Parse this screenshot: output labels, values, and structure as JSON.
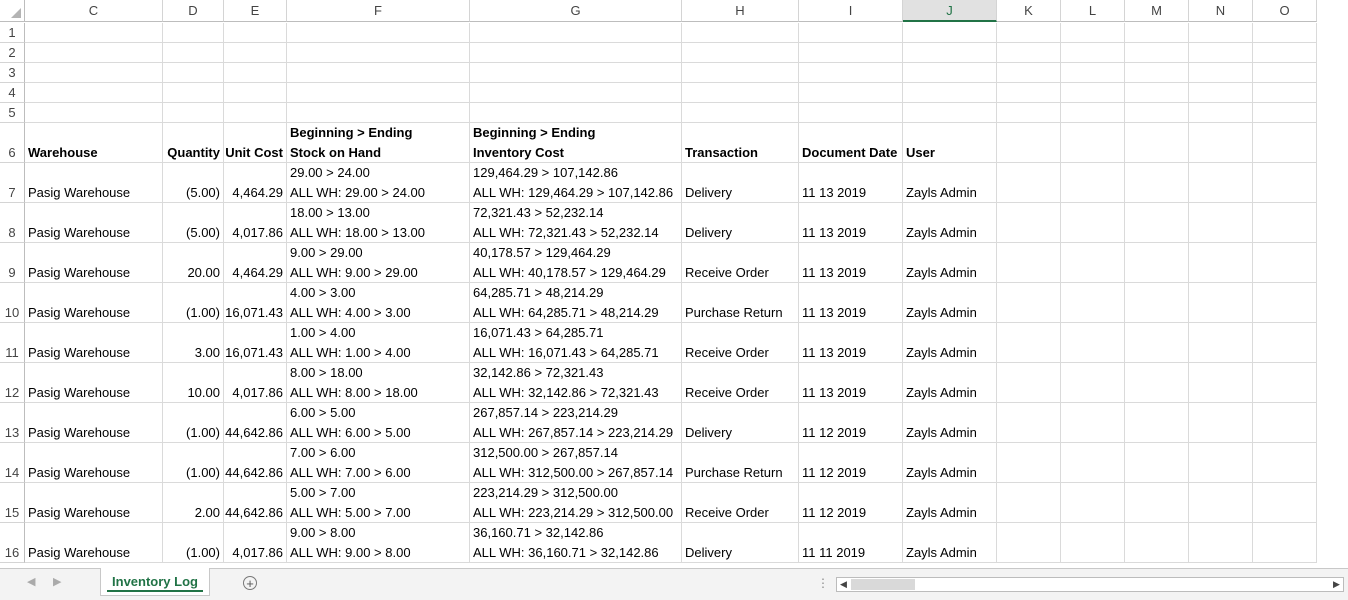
{
  "columns": [
    "C",
    "D",
    "E",
    "F",
    "G",
    "H",
    "I",
    "J",
    "K",
    "L",
    "M",
    "N",
    "O"
  ],
  "selected_column": "J",
  "empty_rows": [
    "1",
    "2",
    "3",
    "4",
    "5"
  ],
  "header_row": {
    "num": "6",
    "warehouse": "Warehouse",
    "quantity": "Quantity",
    "unit_cost": "Unit Cost",
    "stock_top": "Beginning > Ending",
    "stock_bottom": "Stock on Hand",
    "inv_top": "Beginning > Ending",
    "inv_bottom": "Inventory Cost",
    "transaction": "Transaction",
    "document_date": "Document Date",
    "user": "User"
  },
  "rows": [
    {
      "num": "7",
      "warehouse": "Pasig Warehouse",
      "quantity": "(5.00)",
      "unit_cost": "4,464.29",
      "stock_top": "29.00 > 24.00",
      "stock_bottom": "ALL WH: 29.00 > 24.00",
      "inv_top": "129,464.29 > 107,142.86",
      "inv_bottom": "ALL WH: 129,464.29 > 107,142.86",
      "transaction": "Delivery",
      "date": "11 13 2019",
      "user": "Zayls Admin"
    },
    {
      "num": "8",
      "warehouse": "Pasig Warehouse",
      "quantity": "(5.00)",
      "unit_cost": "4,017.86",
      "stock_top": "18.00 > 13.00",
      "stock_bottom": "ALL WH: 18.00 > 13.00",
      "inv_top": "72,321.43 > 52,232.14",
      "inv_bottom": "ALL WH: 72,321.43 > 52,232.14",
      "transaction": "Delivery",
      "date": "11 13 2019",
      "user": "Zayls Admin"
    },
    {
      "num": "9",
      "warehouse": "Pasig Warehouse",
      "quantity": "20.00",
      "unit_cost": "4,464.29",
      "stock_top": "9.00 > 29.00",
      "stock_bottom": "ALL WH: 9.00 > 29.00",
      "inv_top": "40,178.57 > 129,464.29",
      "inv_bottom": "ALL WH: 40,178.57 > 129,464.29",
      "transaction": "Receive Order",
      "date": "11 13 2019",
      "user": "Zayls Admin"
    },
    {
      "num": "10",
      "warehouse": "Pasig Warehouse",
      "quantity": "(1.00)",
      "unit_cost": "16,071.43",
      "stock_top": "4.00 > 3.00",
      "stock_bottom": "ALL WH: 4.00 > 3.00",
      "inv_top": "64,285.71 > 48,214.29",
      "inv_bottom": "ALL WH: 64,285.71 > 48,214.29",
      "transaction": "Purchase Return",
      "date": "11 13 2019",
      "user": "Zayls Admin"
    },
    {
      "num": "11",
      "warehouse": "Pasig Warehouse",
      "quantity": "3.00",
      "unit_cost": "16,071.43",
      "stock_top": "1.00 > 4.00",
      "stock_bottom": "ALL WH: 1.00 > 4.00",
      "inv_top": "16,071.43 > 64,285.71",
      "inv_bottom": "ALL WH: 16,071.43 > 64,285.71",
      "transaction": "Receive Order",
      "date": "11 13 2019",
      "user": "Zayls Admin"
    },
    {
      "num": "12",
      "warehouse": "Pasig Warehouse",
      "quantity": "10.00",
      "unit_cost": "4,017.86",
      "stock_top": "8.00 > 18.00",
      "stock_bottom": "ALL WH: 8.00 > 18.00",
      "inv_top": "32,142.86 > 72,321.43",
      "inv_bottom": "ALL WH: 32,142.86 > 72,321.43",
      "transaction": "Receive Order",
      "date": "11 13 2019",
      "user": "Zayls Admin"
    },
    {
      "num": "13",
      "warehouse": "Pasig Warehouse",
      "quantity": "(1.00)",
      "unit_cost": "44,642.86",
      "stock_top": "6.00 > 5.00",
      "stock_bottom": "ALL WH: 6.00 > 5.00",
      "inv_top": "267,857.14 > 223,214.29",
      "inv_bottom": "ALL WH: 267,857.14 > 223,214.29",
      "transaction": "Delivery",
      "date": "11 12 2019",
      "user": "Zayls Admin"
    },
    {
      "num": "14",
      "warehouse": "Pasig Warehouse",
      "quantity": "(1.00)",
      "unit_cost": "44,642.86",
      "stock_top": "7.00 > 6.00",
      "stock_bottom": "ALL WH: 7.00 > 6.00",
      "inv_top": "312,500.00 > 267,857.14",
      "inv_bottom": "ALL WH: 312,500.00 > 267,857.14",
      "transaction": "Purchase Return",
      "date": "11 12 2019",
      "user": "Zayls Admin"
    },
    {
      "num": "15",
      "warehouse": "Pasig Warehouse",
      "quantity": "2.00",
      "unit_cost": "44,642.86",
      "stock_top": "5.00 > 7.00",
      "stock_bottom": "ALL WH: 5.00 > 7.00",
      "inv_top": "223,214.29 > 312,500.00",
      "inv_bottom": "ALL WH: 223,214.29 > 312,500.00",
      "transaction": "Receive Order",
      "date": "11 12 2019",
      "user": "Zayls Admin"
    },
    {
      "num": "16",
      "warehouse": "Pasig Warehouse",
      "quantity": "(1.00)",
      "unit_cost": "4,017.86",
      "stock_top": "9.00 > 8.00",
      "stock_bottom": "ALL WH: 9.00 > 8.00",
      "inv_top": "36,160.71 > 32,142.86",
      "inv_bottom": "ALL WH: 36,160.71 > 32,142.86",
      "transaction": "Delivery",
      "date": "11 11 2019",
      "user": "Zayls Admin"
    }
  ],
  "sheet_tab": "Inventory Log",
  "icons": {
    "add_sheet": "plus-circle-icon",
    "scroll_left": "triangle-left-icon",
    "scroll_right": "triangle-right-icon",
    "tab_prev": "triangle-left-icon",
    "tab_next": "triangle-right-icon"
  },
  "colors": {
    "accent": "#217346"
  }
}
